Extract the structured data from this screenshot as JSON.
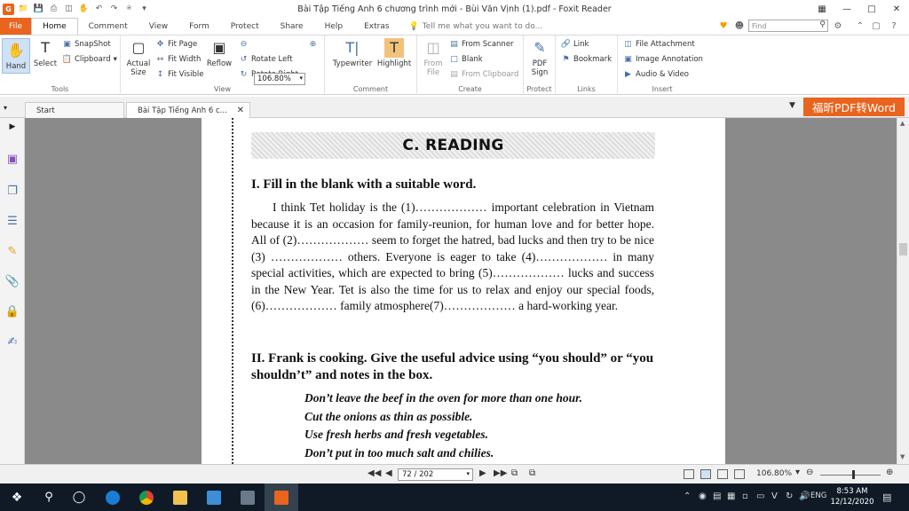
{
  "app": {
    "title": "Bài Tập Tiếng Anh 6 chương trình mới - Bùi Văn Vịnh (1).pdf - Foxit Reader",
    "logo_letter": "G"
  },
  "ribbon_tabs": [
    "File",
    "Home",
    "Comment",
    "View",
    "Form",
    "Protect",
    "Share",
    "Help",
    "Extras"
  ],
  "tell_me": "Tell me what you want to do...",
  "find_placeholder": "Find",
  "tools_group": {
    "label": "Tools",
    "hand": "Hand",
    "select": "Select",
    "snapshot": "SnapShot",
    "clipboard": "Clipboard"
  },
  "view_group": {
    "label": "View",
    "actual_size": "Actual Size",
    "fit_page": "Fit Page",
    "fit_width": "Fit Width",
    "fit_visible": "Fit Visible",
    "reflow": "Reflow",
    "zoom": "106.80%",
    "rotate_left": "Rotate Left",
    "rotate_right": "Rotate Right"
  },
  "comment_group": {
    "label": "Comment",
    "typewriter": "Typewriter",
    "highlight": "Highlight"
  },
  "create_group": {
    "label": "Create",
    "from_file": "From File",
    "from_scanner": "From Scanner",
    "blank": "Blank",
    "from_clipboard": "From Clipboard"
  },
  "protect_group": {
    "label": "Protect",
    "pdf_sign": "PDF Sign"
  },
  "links_group": {
    "label": "Links",
    "link": "Link",
    "bookmark": "Bookmark"
  },
  "insert_group": {
    "label": "Insert",
    "file_attachment": "File Attachment",
    "image_annotation": "Image Annotation",
    "audio_video": "Audio & Video"
  },
  "doc_tabs": {
    "start": "Start",
    "current": "Bài Tập Tiếng Anh 6 c..."
  },
  "promo": "福昕PDF转Word",
  "page": {
    "heading": "C. READING",
    "section1_title": "I. Fill in the blank with a suitable word.",
    "paragraph": "I think Tet holiday is the (1)……………… important celebration in Vietnam because it is an occasion for family-reunion, for human love and for better hope. All of (2)……………… seem to forget the hatred, bad lucks and then try to be nice (3) ……………… others. Everyone is eager to take (4)……………… in many special activities, which are expected to bring (5)……………… lucks and success in the New Year. Tet is also the time for us to relax and enjoy our special foods, (6)……………… family atmosphere(7)……………… a hard-working year.",
    "section2_title": "II. Frank is cooking. Give the useful advice using “you should” or “you shouldn’t” and notes in the box.",
    "notes": [
      "Don’t leave the beef in the oven for more than one hour.",
      "Cut the onions as thin as possible.",
      "Use fresh herbs and fresh vegetables.",
      "Don’t put in too much salt and chilies."
    ]
  },
  "status": {
    "page_indicator": "72 / 202",
    "zoom": "106.80%"
  },
  "taskbar": {
    "time": "8:53 AM",
    "date": "12/12/2020",
    "lang": "ENG"
  }
}
